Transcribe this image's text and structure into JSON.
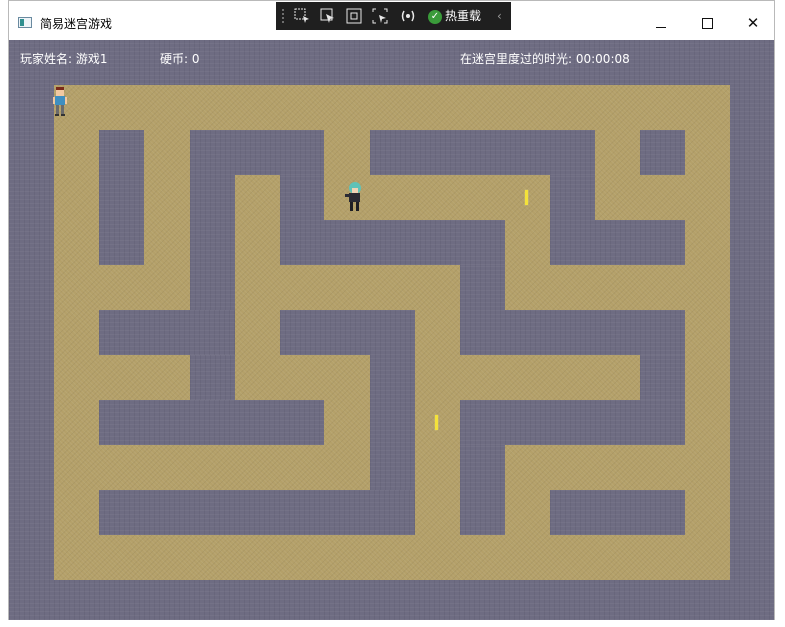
{
  "window": {
    "title": "简易迷宫游戏",
    "minimize_glyph": "",
    "close_glyph": "✕"
  },
  "xaml_toolbar": {
    "hot_reload_label": "热重载",
    "icons": [
      "select-element-icon",
      "pointer-icon",
      "display-layout-icon",
      "track-focus-icon",
      "binding-icon",
      "hot-reload-check-icon",
      "collapse-chevron-icon"
    ]
  },
  "hud": {
    "player_label": "玩家姓名: 游戏1",
    "coins_label": "硬币: 0",
    "time_label": "在迷宫里度过的时光: 00:00:08"
  },
  "colors": {
    "wall": "#6e6c82",
    "floor": "#b4a069",
    "coin": "#f4e23a",
    "toolbar": "#1f1f1f"
  }
}
